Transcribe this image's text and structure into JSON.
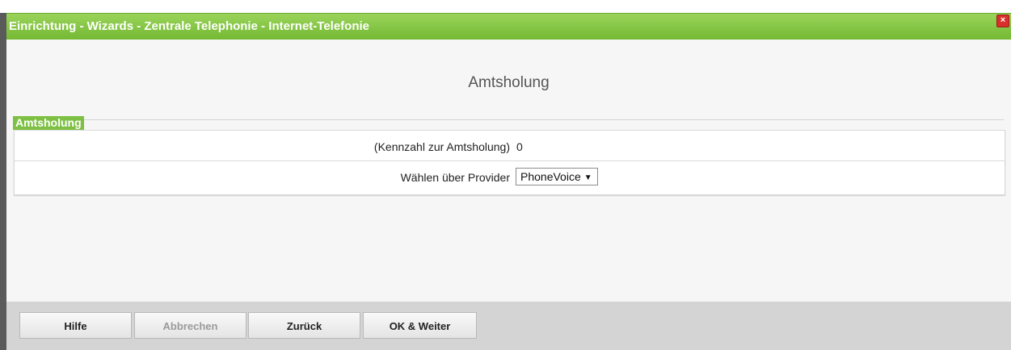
{
  "dialog": {
    "title": "Einrichtung - Wizards - Zentrale Telephonie - Internet-Telefonie",
    "close_icon": "close-icon",
    "close_glyph": "×"
  },
  "content": {
    "heading": "Amtsholung",
    "section_label": "Amtsholung",
    "rows": [
      {
        "label": "(Kennzahl zur Amtsholung)",
        "value": "0"
      },
      {
        "label": "Wählen über Provider",
        "selected": "PhoneVoice"
      }
    ],
    "dropdown_arrow_icon": "chevron-down-icon"
  },
  "footer": {
    "buttons": [
      {
        "label": "Hilfe",
        "enabled": true
      },
      {
        "label": "Abbrechen",
        "enabled": false
      },
      {
        "label": "Zurück",
        "enabled": true
      },
      {
        "label": "OK & Weiter",
        "enabled": true
      }
    ]
  },
  "colors": {
    "titlebar_green": "#7dc043",
    "close_red": "#d9302c",
    "footer_gray": "#d4d4d4"
  }
}
